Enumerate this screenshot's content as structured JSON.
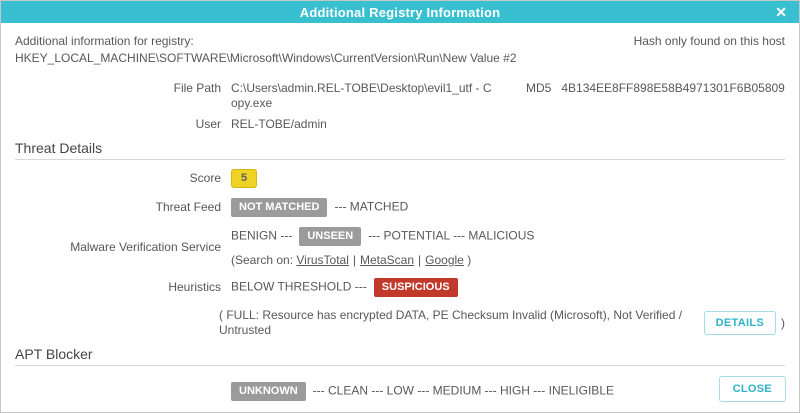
{
  "dialog": {
    "title": "Additional Registry Information",
    "close_icon": "✕"
  },
  "colors": {
    "accent_teal": "#38bfd0",
    "badge_gray": "#9b9b9b",
    "badge_yellow": "#f0d225",
    "badge_red": "#c0392b",
    "button_text": "#2fb3c9",
    "body_text": "#585858"
  },
  "header_info": {
    "label": "Additional information for registry:",
    "registry_path": "HKEY_LOCAL_MACHINE\\SOFTWARE\\Microsoft\\Windows\\CurrentVersion\\Run\\New Value #2",
    "hash_note": "Hash only found on this host"
  },
  "fields": {
    "file_path_label": "File Path",
    "file_path_lines": [
      "C:\\Users\\admin.REL-TOBE\\Desktop\\evil1_utf - C",
      "opy.exe"
    ],
    "md5_label": "MD5",
    "md5_value": "4B134EE8FF898E58B4971301F6B05809",
    "user_label": "User",
    "user_value": "REL-TOBE/admin"
  },
  "threat_details": {
    "section_title": "Threat Details",
    "score": {
      "label": "Score",
      "value": "5"
    },
    "threat_feed": {
      "label": "Threat Feed",
      "badge": "NOT MATCHED",
      "after": "--- MATCHED"
    },
    "mvs": {
      "label": "Malware Verification Service",
      "before": "BENIGN ---",
      "badge": "UNSEEN",
      "after": "--- POTENTIAL --- MALICIOUS",
      "search_prefix": "(Search on:",
      "links": [
        "VirusTotal",
        "MetaScan",
        "Google"
      ],
      "link_separator": "|",
      "search_suffix": ")"
    },
    "heuristics": {
      "label": "Heuristics",
      "before": "BELOW THRESHOLD ---",
      "badge": "SUSPICIOUS"
    },
    "full_note_prefix": "( FULL: Resource has encrypted DATA, PE Checksum Invalid (Microsoft), Not Verified / Untrusted",
    "details_button": "DETAILS",
    "full_note_suffix": ")"
  },
  "apt_blocker": {
    "section_title": "APT Blocker",
    "badge": "UNKNOWN",
    "after": "--- CLEAN --- LOW --- MEDIUM --- HIGH --- INELIGIBLE"
  },
  "footer": {
    "close_button": "CLOSE"
  }
}
